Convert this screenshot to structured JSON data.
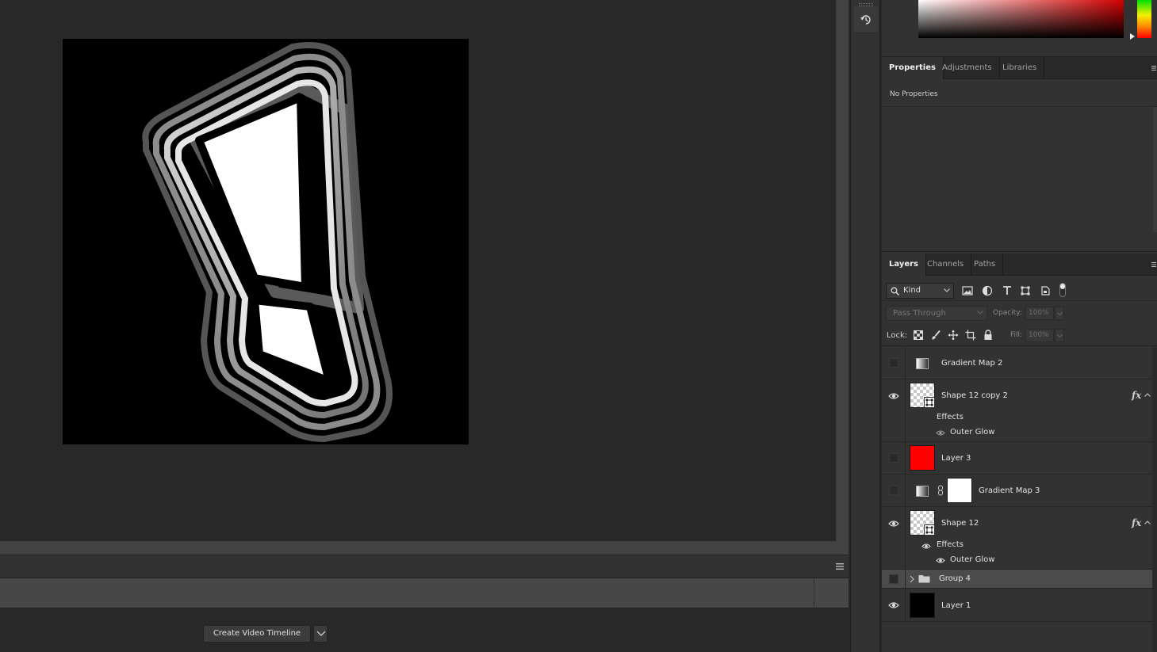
{
  "timeline": {
    "create_button": "Create Video Timeline"
  },
  "properties_panel": {
    "tabs": [
      "Properties",
      "Adjustments",
      "Libraries"
    ],
    "active_tab": "Properties",
    "body_text": "No Properties"
  },
  "layers_panel": {
    "tabs": [
      "Layers",
      "Channels",
      "Paths"
    ],
    "active_tab": "Layers",
    "filter_kind": "Kind",
    "blend_mode": "Pass Through",
    "opacity_label": "Opacity:",
    "opacity_value": "100%",
    "lock_label": "Lock:",
    "fill_label": "Fill:",
    "fill_value": "100%",
    "layers": [
      {
        "name": "Gradient Map 2",
        "type": "adjustment",
        "visible": false
      },
      {
        "name": "Shape 12 copy 2",
        "type": "shape",
        "visible": true,
        "fx": "fx",
        "effects_label": "Effects",
        "effects": [
          "Outer Glow"
        ]
      },
      {
        "name": "Layer 3",
        "type": "pixel",
        "visible": false,
        "thumb_color": "#ff0000"
      },
      {
        "name": "Gradient Map 3",
        "type": "adjustment-mask",
        "visible": false
      },
      {
        "name": "Shape 12",
        "type": "shape",
        "visible": true,
        "fx": "fx",
        "effects_label": "Effects",
        "effects": [
          "Outer Glow"
        ]
      },
      {
        "name": "Group 4",
        "type": "group",
        "visible": false,
        "selected": true
      },
      {
        "name": "Layer 1",
        "type": "pixel",
        "visible": true,
        "thumb_color": "#000000"
      }
    ]
  },
  "icons": {
    "tool_strip": [
      "history-icon"
    ],
    "filters": [
      "image-filter-icon",
      "adjustment-filter-icon",
      "type-filter-icon",
      "shape-filter-icon",
      "smart-object-filter-icon"
    ],
    "locks": [
      "lock-transparent-icon",
      "lock-paint-icon",
      "lock-move-icon",
      "lock-artboard-icon",
      "lock-all-icon"
    ]
  },
  "colors": {
    "ui_background": "#282828",
    "panel_background": "#323232",
    "selected_layer": "#4b4b4b",
    "canvas": "#000000"
  }
}
